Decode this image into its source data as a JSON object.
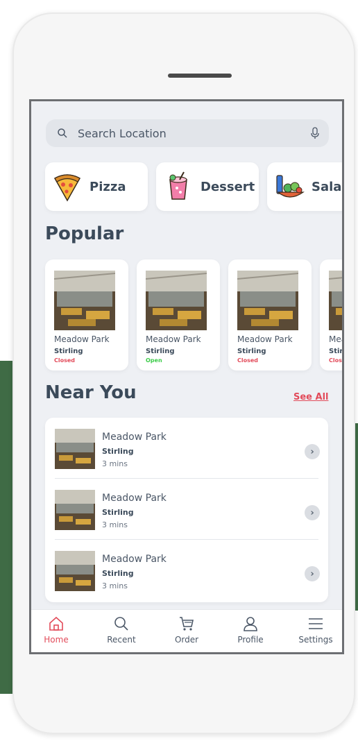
{
  "search": {
    "placeholder": "Search Location"
  },
  "categories": [
    {
      "label": "Pizza",
      "icon": "pizza-icon"
    },
    {
      "label": "Dessert",
      "icon": "dessert-icon"
    },
    {
      "label": "Salad",
      "icon": "salad-icon"
    }
  ],
  "popular": {
    "title": "Popular",
    "items": [
      {
        "name": "Meadow Park",
        "city": "Stirling",
        "status": "Closed"
      },
      {
        "name": "Meadow Park",
        "city": "Stirling",
        "status": "Open"
      },
      {
        "name": "Meadow Park",
        "city": "Stirling",
        "status": "Closed"
      },
      {
        "name": "Meadow Park",
        "city": "Stirling",
        "status": "Closed"
      }
    ]
  },
  "near": {
    "title": "Near You",
    "see_all": "See All",
    "items": [
      {
        "name": "Meadow Park",
        "city": "Stirling",
        "time": "3 mins"
      },
      {
        "name": "Meadow Park",
        "city": "Stirling",
        "time": "3 mins"
      },
      {
        "name": "Meadow Park",
        "city": "Stirling",
        "time": "3 mins"
      }
    ]
  },
  "tabs": [
    {
      "label": "Home",
      "icon": "home-icon",
      "active": true
    },
    {
      "label": "Recent",
      "icon": "search-icon",
      "active": false
    },
    {
      "label": "Order",
      "icon": "cart-icon",
      "active": false
    },
    {
      "label": "Profile",
      "icon": "user-icon",
      "active": false
    },
    {
      "label": "Settings",
      "icon": "menu-icon",
      "active": false
    }
  ],
  "colors": {
    "accent": "#e24b5a",
    "open": "#3dcc4a",
    "text": "#3b4a5a",
    "screen_bg": "#eef0f4"
  }
}
